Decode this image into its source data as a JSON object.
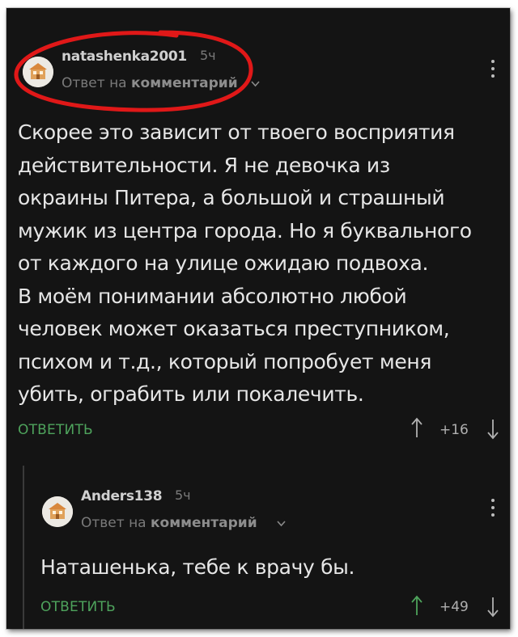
{
  "comment1": {
    "username": "natashenka2001",
    "time": "5ч",
    "reply_prefix": "Ответ на ",
    "reply_target": "комментарий",
    "lines": [
      "Скорее это зависит от твоего восприятия",
      "действительности. Я не девочка из",
      "окраины Питера, а большой и страшный",
      "мужик из центра города. Но я буквального",
      "от каждого на улице ожидаю подвоха.",
      "В моём понимании абсолютно любой",
      "человек может оказаться преступником,",
      "психом и т.д., который попробует меня",
      "убить, ограбить или покалечить."
    ],
    "reply_label": "ОТВЕТИТЬ",
    "score": "+16"
  },
  "comment2": {
    "username": "Anders138",
    "time": "5ч",
    "reply_prefix": "Ответ на ",
    "reply_target": "комментарий",
    "lines": [
      "Наташенька, тебе к врачу бы."
    ],
    "reply_label": "ОТВЕТИТЬ",
    "score": "+49"
  },
  "colors": {
    "background": "#141414",
    "reply_green": "#4ea35c",
    "highlight_circle": "#e01818"
  },
  "icons": [
    "avatar",
    "chevron-down-icon",
    "kebab-menu-icon",
    "upvote-arrow-icon",
    "downvote-arrow-icon"
  ]
}
